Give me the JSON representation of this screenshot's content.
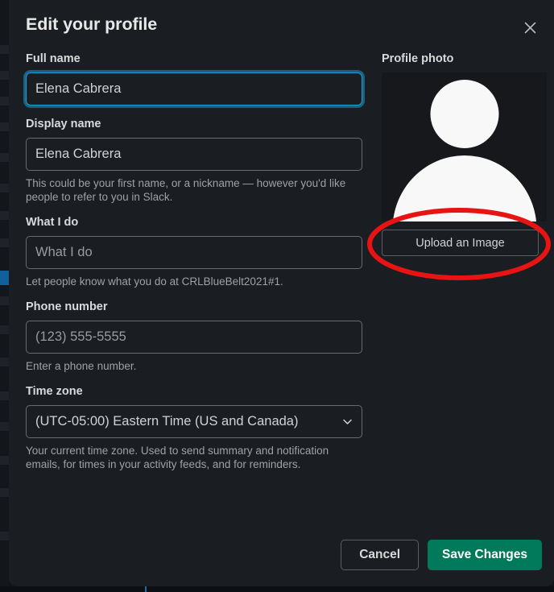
{
  "modal": {
    "title": "Edit your profile",
    "close_icon": "close-icon"
  },
  "form": {
    "full_name": {
      "label": "Full name",
      "value": "Elena Cabrera",
      "placeholder": "Full name",
      "focused": true
    },
    "display_name": {
      "label": "Display name",
      "value": "Elena Cabrera",
      "placeholder": "Display name",
      "helper": "This could be your first name, or a nickname — however you'd like people to refer to you in Slack."
    },
    "what_i_do": {
      "label": "What I do",
      "value": "",
      "placeholder": "What I do",
      "helper": "Let people know what you do at CRLBlueBelt2021#1."
    },
    "phone_number": {
      "label": "Phone number",
      "value": "",
      "placeholder": "(123) 555-5555",
      "helper": "Enter a phone number."
    },
    "time_zone": {
      "label": "Time zone",
      "value": "(UTC-05:00) Eastern Time (US and Canada)",
      "helper": "Your current time zone. Used to send summary and notification emails, for times in your activity feeds, and for reminders.",
      "chevron_icon": "chevron-down-icon"
    }
  },
  "photo": {
    "label": "Profile photo",
    "avatar_icon": "default-avatar-icon",
    "upload_label": "Upload an Image"
  },
  "annotation": {
    "shape": "red-ellipse-highlight",
    "color": "#e81414",
    "target": "Upload an Image"
  },
  "footer": {
    "cancel_label": "Cancel",
    "save_label": "Save Changes",
    "save_color": "#007a5a"
  },
  "colors": {
    "modal_background": "#1a1d21",
    "app_background": "#121417",
    "focus_ring": "#1d9bd1",
    "text_primary": "#d9dadb",
    "text_helper": "#9fa1a4"
  }
}
